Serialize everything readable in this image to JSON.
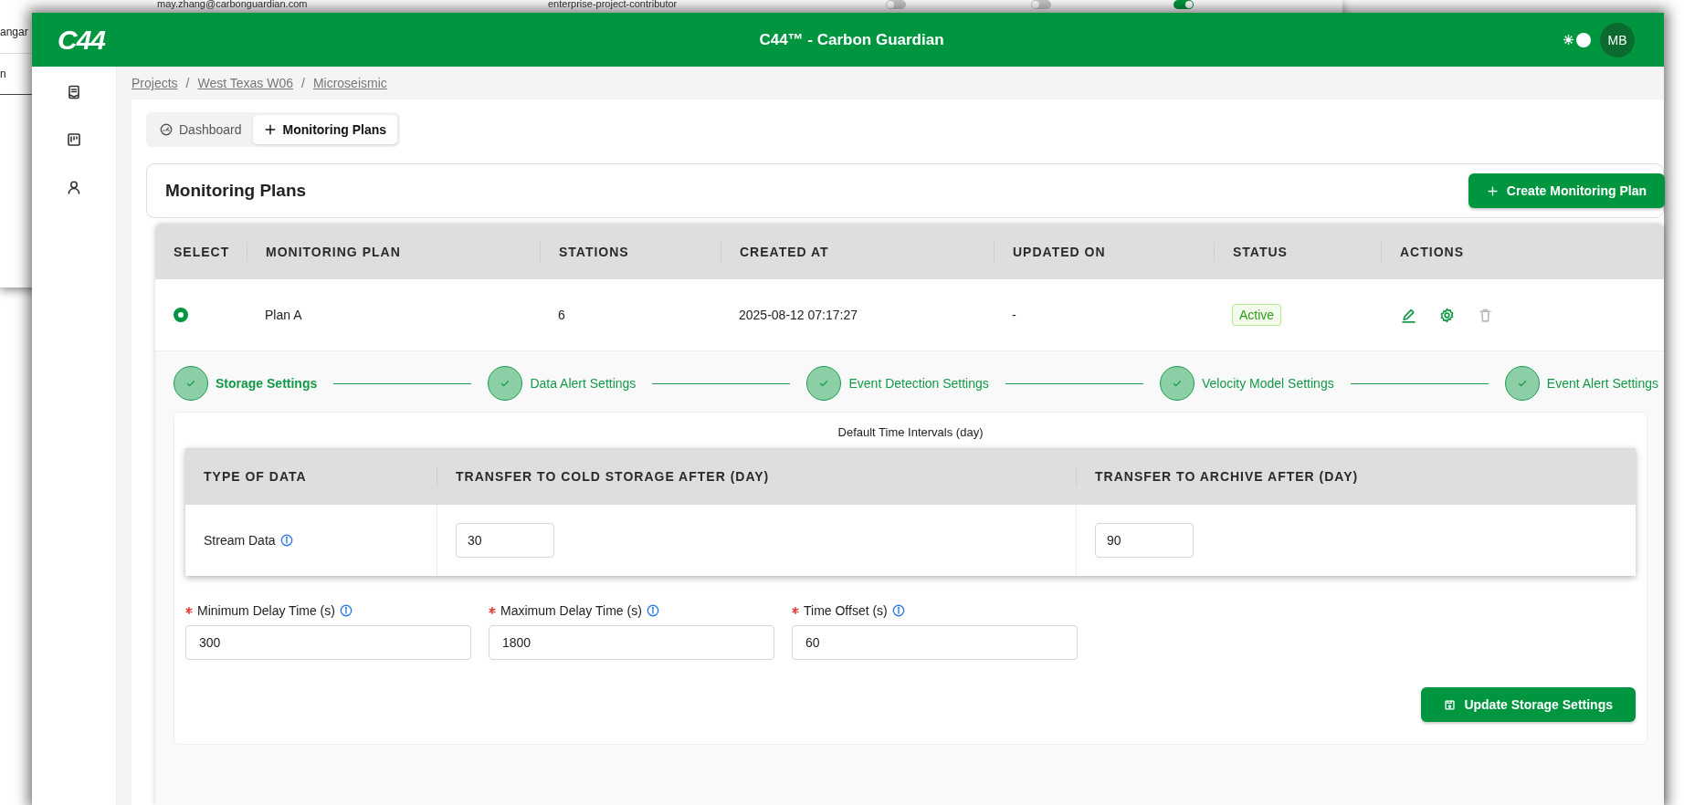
{
  "background_window": {
    "texts": [
      "may.zhang@carbonguardian.com",
      "enterprise-project-contributor"
    ],
    "toggles": [
      {
        "on": false
      },
      {
        "on": false
      },
      {
        "on": true
      }
    ],
    "rows": [
      "angar",
      "n"
    ]
  },
  "app": {
    "logo": "C44",
    "title": "C44™ - Carbon Guardian",
    "theme_toggle": {
      "on": true
    },
    "avatar": "MB"
  },
  "breadcrumb": [
    {
      "kind": "link",
      "text": "Projects"
    },
    {
      "kind": "separator",
      "text": "/"
    },
    {
      "kind": "link",
      "text": "West Texas W06"
    },
    {
      "kind": "separator",
      "text": "/"
    },
    {
      "kind": "link",
      "text": "Microseismic"
    }
  ],
  "tabs": [
    {
      "label": "Dashboard",
      "kind": "gauge",
      "selected": false
    },
    {
      "label": "Monitoring Plans",
      "kind": "plus",
      "selected": true
    }
  ],
  "panel": {
    "title": "Monitoring Plans",
    "create_button": "Create Monitoring Plan"
  },
  "table": {
    "columns": [
      "SELECT",
      "MONITORING PLAN",
      "STATIONS",
      "CREATED AT",
      "UPDATED ON",
      "STATUS",
      "ACTIONS"
    ],
    "rows": [
      {
        "selected": true,
        "plan": "Plan A",
        "stations": "6",
        "created_at": "2025-08-12 07:17:27",
        "updated_on": "-",
        "status": "Active",
        "actions": [
          {
            "kind": "edit",
            "disabled": false
          },
          {
            "kind": "settings",
            "disabled": false
          },
          {
            "kind": "delete",
            "disabled": true
          }
        ]
      }
    ]
  },
  "steps": [
    {
      "label": "Storage Settings",
      "done": true,
      "selected": true
    },
    {
      "label": "Data Alert Settings",
      "done": true,
      "selected": false
    },
    {
      "label": "Event Detection Settings",
      "done": true,
      "selected": false
    },
    {
      "label": "Velocity Model Settings",
      "done": true,
      "selected": false
    },
    {
      "label": "Event Alert Settings",
      "done": true,
      "selected": false
    }
  ],
  "storage": {
    "caption": "Default Time Intervals (day)",
    "columns": [
      "TYPE OF DATA",
      "TRANSFER TO COLD STORAGE AFTER (DAY)",
      "TRANSFER TO ARCHIVE AFTER (DAY)"
    ],
    "rows": [
      {
        "type": "Stream Data",
        "info": true,
        "cold": "30",
        "archive": "90"
      }
    ],
    "fields": [
      {
        "label": "Minimum Delay Time (s)",
        "required": true,
        "info": true,
        "value": "300"
      },
      {
        "label": "Maximum Delay Time (s)",
        "required": true,
        "info": true,
        "value": "1800"
      },
      {
        "label": "Time Offset (s)",
        "required": true,
        "info": true,
        "value": "60"
      }
    ],
    "update_button": "Update Storage Settings"
  }
}
